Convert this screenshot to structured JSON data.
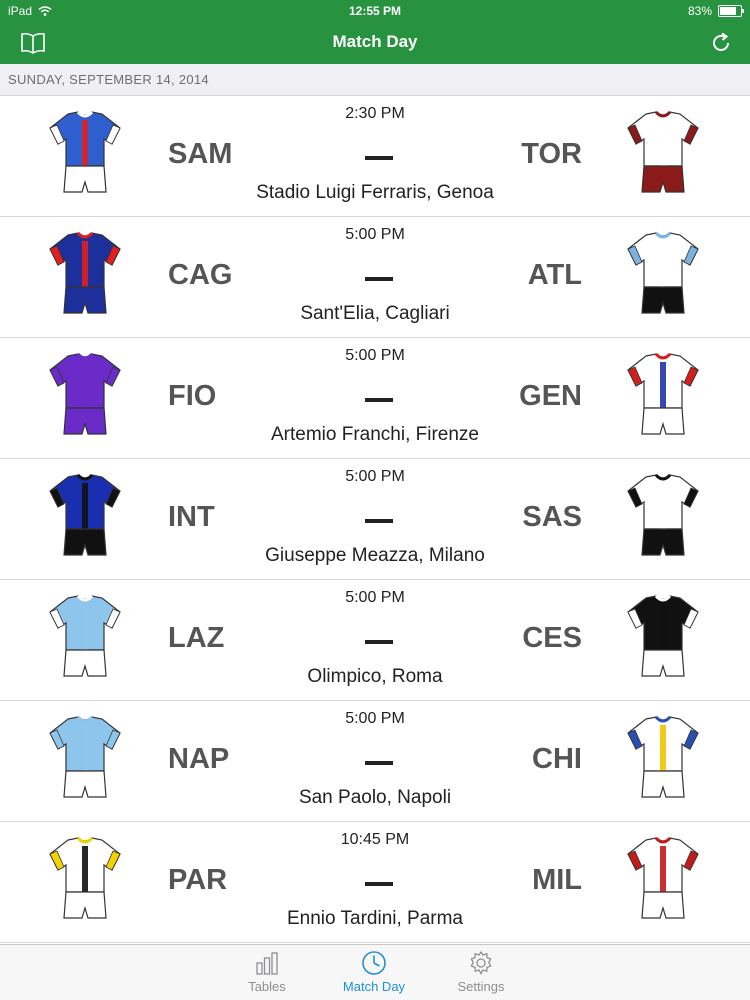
{
  "status_bar": {
    "device": "iPad",
    "time": "12:55 PM",
    "battery": "83%",
    "battery_level": 0.83
  },
  "nav": {
    "title": "Match Day"
  },
  "date_header": "SUNDAY, SEPTEMBER 14, 2014",
  "matches": [
    {
      "time": "2:30 PM",
      "home": "SAM",
      "away": "TOR",
      "venue": "Stadio Luigi Ferraris, Genoa",
      "home_kit": {
        "shirt": "#2f5fcf",
        "accent": "#ffffff",
        "shorts": "#ffffff",
        "stripe": "#d22"
      },
      "away_kit": {
        "shirt": "#ffffff",
        "accent": "#8b1a1a",
        "shorts": "#8b1a1a",
        "stripe": "#ffffff"
      }
    },
    {
      "time": "5:00 PM",
      "home": "CAG",
      "away": "ATL",
      "venue": "Sant'Elia, Cagliari",
      "home_kit": {
        "shirt": "#1c2f9a",
        "accent": "#e21e1e",
        "shorts": "#1c2f9a",
        "stripe": "#e21e1e"
      },
      "away_kit": {
        "shirt": "#ffffff",
        "accent": "#7db2e0",
        "shorts": "#111111",
        "stripe": "#ffffff"
      }
    },
    {
      "time": "5:00 PM",
      "home": "FIO",
      "away": "GEN",
      "venue": "Artemio Franchi, Firenze",
      "home_kit": {
        "shirt": "#6a2bc9",
        "accent": "#6a2bc9",
        "shorts": "#6a2bc9",
        "stripe": "#6a2bc9"
      },
      "away_kit": {
        "shirt": "#ffffff",
        "accent": "#d22020",
        "shorts": "#ffffff",
        "stripe": "#2233aa"
      }
    },
    {
      "time": "5:00 PM",
      "home": "INT",
      "away": "SAS",
      "venue": "Giuseppe Meazza, Milano",
      "home_kit": {
        "shirt": "#1a2fb0",
        "accent": "#111111",
        "shorts": "#111111",
        "stripe": "#111111"
      },
      "away_kit": {
        "shirt": "#ffffff",
        "accent": "#111111",
        "shorts": "#111111",
        "stripe": "#ffffff"
      }
    },
    {
      "time": "5:00 PM",
      "home": "LAZ",
      "away": "CES",
      "venue": "Olimpico, Roma",
      "home_kit": {
        "shirt": "#8ec5ec",
        "accent": "#ffffff",
        "shorts": "#ffffff",
        "stripe": "#8ec5ec"
      },
      "away_kit": {
        "shirt": "#111111",
        "accent": "#ffffff",
        "shorts": "#ffffff",
        "stripe": "#111111"
      }
    },
    {
      "time": "5:00 PM",
      "home": "NAP",
      "away": "CHI",
      "venue": "San Paolo, Napoli",
      "home_kit": {
        "shirt": "#8ec5ec",
        "accent": "#8ec5ec",
        "shorts": "#ffffff",
        "stripe": "#8ec5ec"
      },
      "away_kit": {
        "shirt": "#ffffff",
        "accent": "#2a4fb0",
        "shorts": "#ffffff",
        "stripe": "#f2c400"
      }
    },
    {
      "time": "10:45 PM",
      "home": "PAR",
      "away": "MIL",
      "venue": "Ennio Tardini, Parma",
      "home_kit": {
        "shirt": "#ffffff",
        "accent": "#f2d200",
        "shorts": "#ffffff",
        "stripe": "#111111"
      },
      "away_kit": {
        "shirt": "#ffffff",
        "accent": "#c41a1a",
        "shorts": "#ffffff",
        "stripe": "#c41a1a"
      }
    }
  ],
  "tabs": [
    {
      "label": "Tables",
      "icon": "bar-chart-icon",
      "active": false
    },
    {
      "label": "Match Day",
      "icon": "clock-icon",
      "active": true
    },
    {
      "label": "Settings",
      "icon": "gear-icon",
      "active": false
    }
  ],
  "colors": {
    "nav_green": "#27923f",
    "active_tab": "#1f8fd6"
  }
}
